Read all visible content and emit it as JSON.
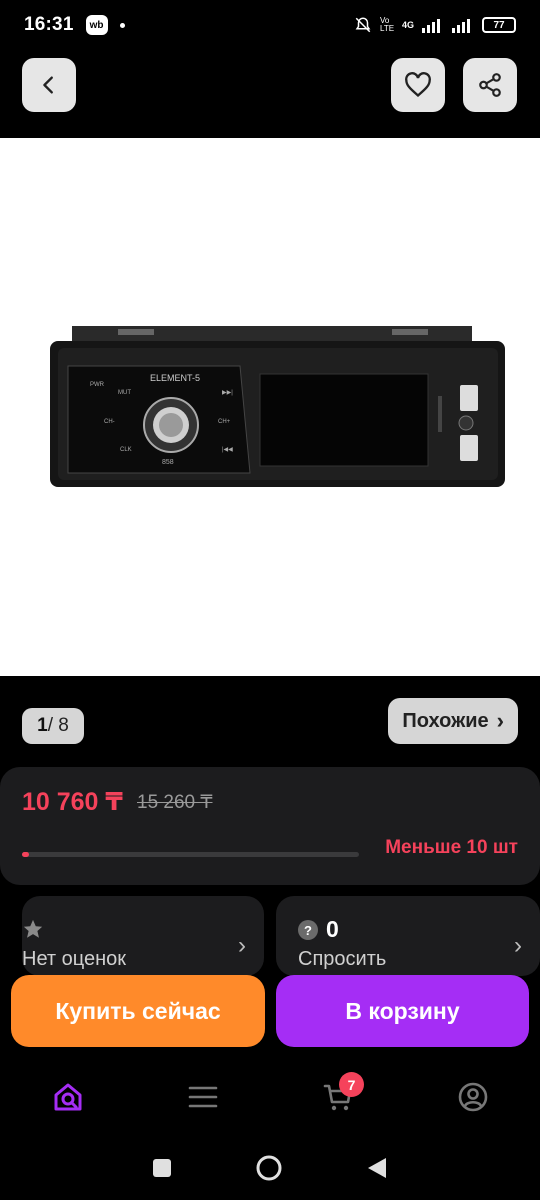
{
  "status_bar": {
    "time": "16:31",
    "app_badge": "wb",
    "battery": "77",
    "network": "4G",
    "volte": "Vo LTE"
  },
  "nav": {
    "back_icon": "chevron-left-icon",
    "favorite_icon": "heart-icon",
    "share_icon": "share-icon"
  },
  "gallery": {
    "current": "1",
    "total": "/ 8"
  },
  "similar": {
    "label": "Похожие",
    "arrow": "›"
  },
  "price": {
    "current": "10 760 ₸",
    "old": "15 260 ₸",
    "stock_text": "Меньше 10 шт",
    "stock_level": 0.02,
    "accent": "#f5425b"
  },
  "rating": {
    "label": "Нет оценок",
    "icon": "star-icon"
  },
  "questions": {
    "count": "0",
    "label": "Спросить",
    "icon": "question-icon"
  },
  "actions": {
    "buy_now": "Купить сейчас",
    "add_to_cart": "В корзину",
    "buy_color": "#ff8a2a",
    "cart_color": "#a52df5"
  },
  "tabs": {
    "cart_count": "7",
    "items": [
      "home-search-icon",
      "menu-icon",
      "cart-icon",
      "profile-icon"
    ]
  }
}
